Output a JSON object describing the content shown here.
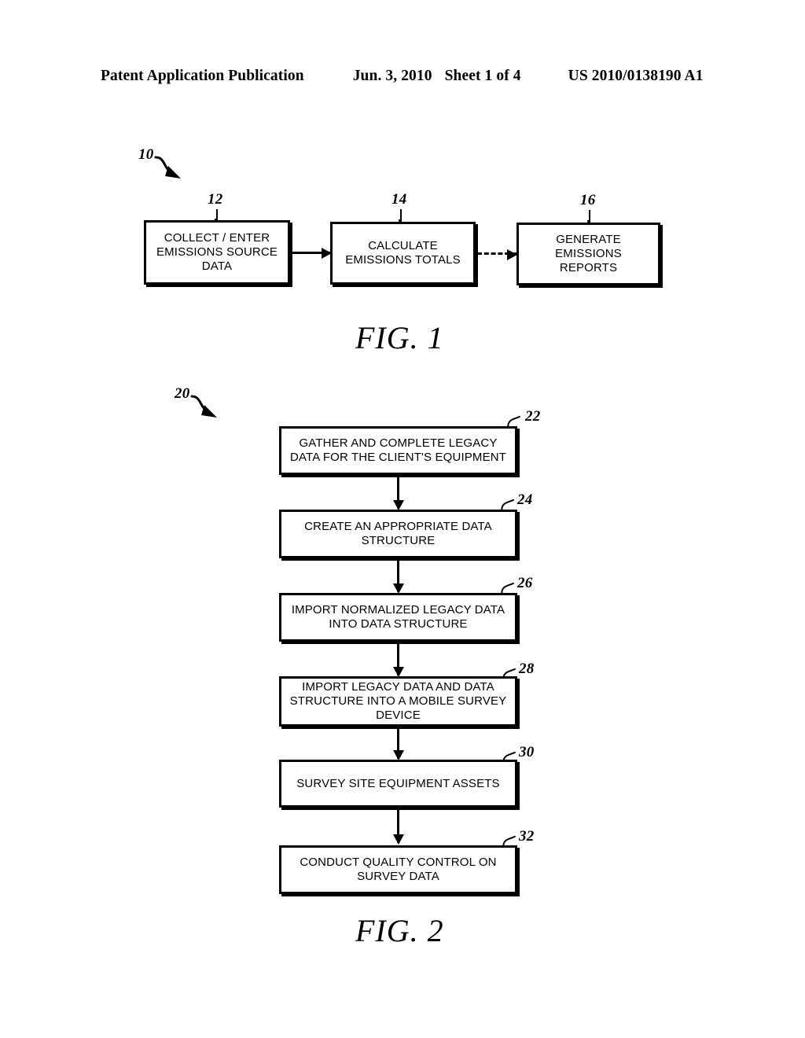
{
  "page": {
    "header": {
      "publication": "Patent Application Publication",
      "date": "Jun. 3, 2010",
      "sheet": "Sheet 1 of 4",
      "patent_number": "US 2010/0138190 A1"
    },
    "ink_color": "#000000",
    "background_color": "#ffffff"
  },
  "figures": [
    {
      "caption": "FIG. 1",
      "system_ref": "10",
      "orientation": "horizontal",
      "steps": [
        {
          "ref": "12",
          "text": "COLLECT / ENTER\nEMISSIONS SOURCE\nDATA",
          "lines": [
            "COLLECT / ENTER",
            "EMISSIONS SOURCE",
            "DATA"
          ]
        },
        {
          "ref": "14",
          "text": "CALCULATE\nEMISSIONS TOTALS",
          "lines": [
            "CALCULATE",
            "EMISSIONS TOTALS"
          ]
        },
        {
          "ref": "16",
          "text": "GENERATE\nEMISSIONS\nREPORTS",
          "lines": [
            "GENERATE",
            "EMISSIONS",
            "REPORTS"
          ]
        }
      ],
      "connectors": [
        {
          "from": "12",
          "to": "14",
          "style": "solid"
        },
        {
          "from": "14",
          "to": "16",
          "style": "dashed"
        }
      ]
    },
    {
      "caption": "FIG. 2",
      "system_ref": "20",
      "orientation": "vertical",
      "steps": [
        {
          "ref": "22",
          "text": "GATHER AND COMPLETE LEGACY\nDATA FOR THE CLIENT'S EQUIPMENT",
          "lines": [
            "GATHER AND COMPLETE LEGACY",
            "DATA FOR THE CLIENT'S EQUIPMENT"
          ]
        },
        {
          "ref": "24",
          "text": "CREATE AN APPROPRIATE DATA\nSTRUCTURE",
          "lines": [
            "CREATE AN APPROPRIATE DATA",
            "STRUCTURE"
          ]
        },
        {
          "ref": "26",
          "text": "IMPORT NORMALIZED LEGACY DATA\nINTO DATA STRUCTURE",
          "lines": [
            "IMPORT NORMALIZED LEGACY DATA",
            "INTO DATA STRUCTURE"
          ]
        },
        {
          "ref": "28",
          "text": "IMPORT LEGACY DATA AND DATA\nSTRUCTURE INTO A MOBILE SURVEY\nDEVICE",
          "lines": [
            "IMPORT LEGACY DATA AND DATA",
            "STRUCTURE INTO A MOBILE SURVEY",
            "DEVICE"
          ]
        },
        {
          "ref": "30",
          "text": "SURVEY SITE EQUIPMENT ASSETS",
          "lines": [
            "SURVEY SITE EQUIPMENT ASSETS"
          ]
        },
        {
          "ref": "32",
          "text": "CONDUCT QUALITY CONTROL ON\nSURVEY DATA",
          "lines": [
            "CONDUCT QUALITY CONTROL ON",
            "SURVEY DATA"
          ]
        }
      ],
      "connectors": [
        {
          "from": "22",
          "to": "24",
          "style": "solid"
        },
        {
          "from": "24",
          "to": "26",
          "style": "solid"
        },
        {
          "from": "26",
          "to": "28",
          "style": "solid"
        },
        {
          "from": "28",
          "to": "30",
          "style": "solid"
        },
        {
          "from": "30",
          "to": "32",
          "style": "solid"
        }
      ]
    }
  ]
}
